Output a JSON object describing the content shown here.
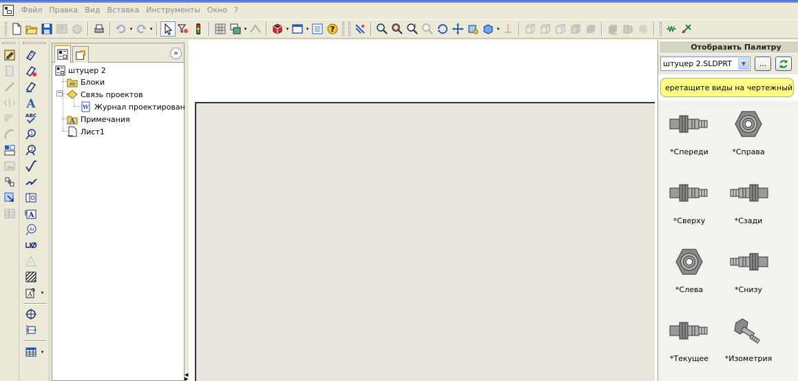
{
  "menu": {
    "items": [
      "Файл",
      "Правка",
      "Вид",
      "Вставка",
      "Инструменты",
      "Окно",
      "?"
    ]
  },
  "feature_tree": {
    "root": "штуцер 2",
    "items": [
      {
        "label": "Блоки",
        "icon": "blocks-folder-icon"
      },
      {
        "label": "Связь проектов",
        "icon": "design-binder-icon"
      },
      {
        "label": "Журнал проектирования.",
        "icon": "design-journal-icon"
      },
      {
        "label": "Примечания",
        "icon": "annotations-icon"
      },
      {
        "label": "Лист1",
        "icon": "sheet-icon"
      }
    ]
  },
  "palette": {
    "title": "Отобразить Палитру",
    "document": "штуцер 2.SLDPRT",
    "browse_label": "...",
    "hint": "еретащите виды на чертежный ли",
    "views": [
      {
        "label": "*Спереди",
        "kind": "side"
      },
      {
        "label": "*Справа",
        "kind": "end"
      },
      {
        "label": "*Сверху",
        "kind": "side"
      },
      {
        "label": "*Сзади",
        "kind": "side-rev"
      },
      {
        "label": "*Слева",
        "kind": "end"
      },
      {
        "label": "*Снизу",
        "kind": "side-rev"
      },
      {
        "label": "*Текущее",
        "kind": "side"
      },
      {
        "label": "*Изометрия",
        "kind": "iso"
      }
    ]
  },
  "colors": {
    "window_bg": "#ece9d8",
    "sheet_bg": "#e8e6dc",
    "hint_bg": "#ffff88",
    "palette_header_bg": "#d6d3c3"
  }
}
